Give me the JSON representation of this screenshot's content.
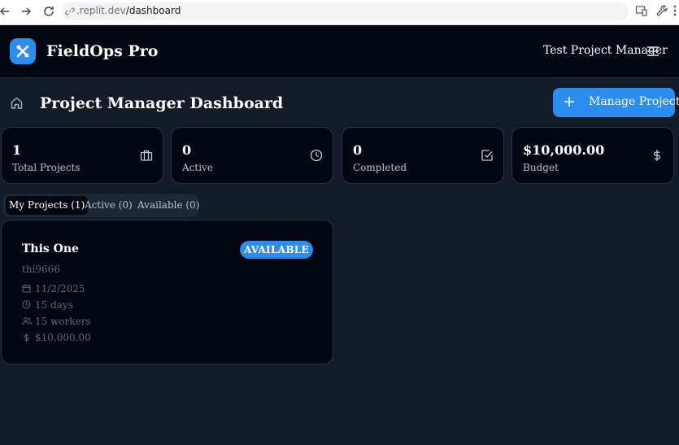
{
  "browser": {
    "url_host": ".replit.dev",
    "url_path": "/dashboard"
  },
  "header": {
    "brand": "FieldOps Pro",
    "user_name": "Test Project Manager"
  },
  "page": {
    "title": "Project Manager Dashboard",
    "manage_button": "Manage Projects"
  },
  "stats": [
    {
      "value": "1",
      "label": "Total Projects",
      "icon": "briefcase-icon"
    },
    {
      "value": "0",
      "label": "Active",
      "icon": "clock-icon"
    },
    {
      "value": "0",
      "label": "Completed",
      "icon": "check-square-icon"
    },
    {
      "value": "$10,000.00",
      "label": "Budget",
      "icon": "dollar-icon"
    }
  ],
  "tabs": [
    {
      "label": "My Projects (1)",
      "active": true
    },
    {
      "label": "Active (0)",
      "active": false
    },
    {
      "label": "Available (0)",
      "active": false
    }
  ],
  "project": {
    "title": "This One",
    "status": "AVAILABLE",
    "code": "thi9666",
    "date": "11/2/2025",
    "duration": "15 days",
    "workers": "15 workers",
    "budget": "$10,000.00"
  },
  "colors": {
    "accent": "#2b8ded",
    "background": "#131a28",
    "card": "#030712"
  }
}
